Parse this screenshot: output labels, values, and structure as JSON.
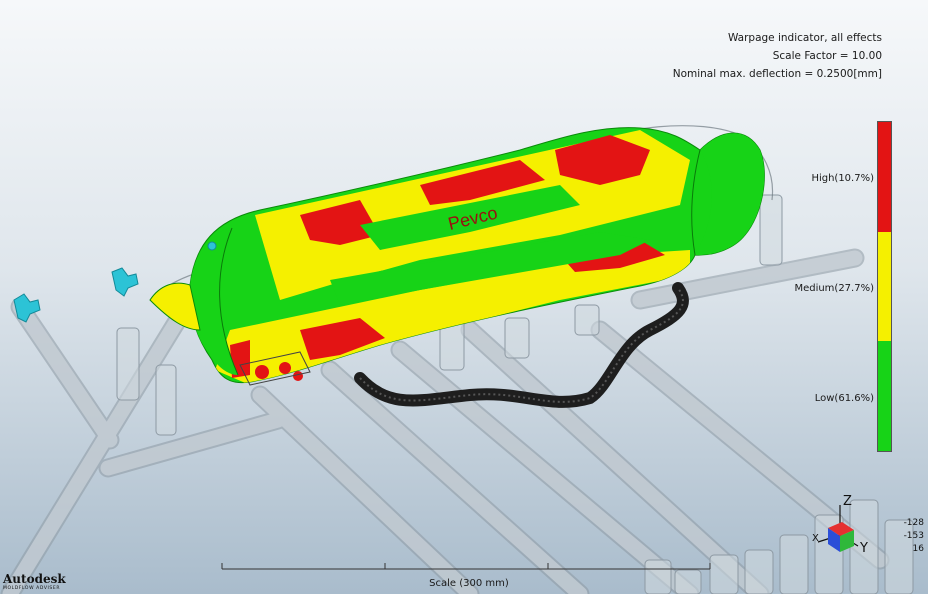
{
  "info": {
    "title": "Warpage indicator, all effects",
    "scale_factor": "Scale Factor = 10.00",
    "nominal_deflection": "Nominal max. deflection = 0.2500[mm]"
  },
  "legend": {
    "high_label": "High(10.7%)",
    "medium_label": "Medium(27.7%)",
    "low_label": "Low(61.6%)",
    "high_fraction": 0.333,
    "medium_fraction": 0.333,
    "low_fraction": 0.333,
    "colors": {
      "high": "#e31414",
      "medium": "#f5f000",
      "low": "#17d317"
    }
  },
  "part": {
    "logo_text": "Pevco"
  },
  "scale_bar": {
    "caption": "Scale (300 mm)"
  },
  "triad": {
    "z_label": "Z",
    "y_label": "Y",
    "x_label": "X"
  },
  "coords": {
    "x": "-128",
    "y": "-153",
    "z": "16"
  },
  "branding": {
    "name": "Autodesk",
    "product": "MOLDFLOW ADVISER"
  },
  "colors": {
    "pipe": "#c4cdd4",
    "hose": "#1e1e1e",
    "connector": "#2cc3d6"
  }
}
